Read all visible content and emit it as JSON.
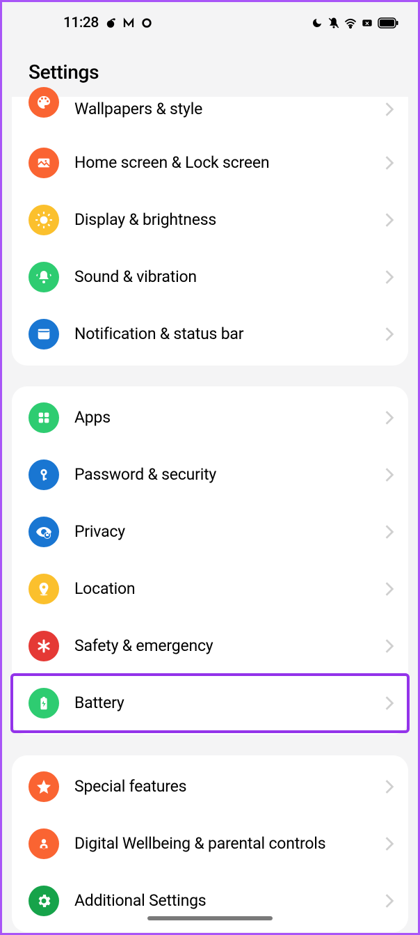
{
  "statusBar": {
    "time": "11:28"
  },
  "header": {
    "title": "Settings"
  },
  "groups": [
    {
      "items": [
        {
          "label": "Wallpapers & style",
          "icon": "palette",
          "color": "orange"
        },
        {
          "label": "Home screen & Lock screen",
          "icon": "image",
          "color": "orange"
        },
        {
          "label": "Display & brightness",
          "icon": "sun",
          "color": "yellow"
        },
        {
          "label": "Sound & vibration",
          "icon": "bell",
          "color": "green"
        },
        {
          "label": "Notification & status bar",
          "icon": "notification",
          "color": "blue"
        }
      ]
    },
    {
      "items": [
        {
          "label": "Apps",
          "icon": "apps",
          "color": "green"
        },
        {
          "label": "Password & security",
          "icon": "key",
          "color": "blue"
        },
        {
          "label": "Privacy",
          "icon": "eye",
          "color": "blue"
        },
        {
          "label": "Location",
          "icon": "location",
          "color": "yellow"
        },
        {
          "label": "Safety & emergency",
          "icon": "asterisk",
          "color": "red"
        },
        {
          "label": "Battery",
          "icon": "battery",
          "color": "green",
          "highlighted": true
        }
      ]
    },
    {
      "items": [
        {
          "label": "Special features",
          "icon": "star",
          "color": "orange"
        },
        {
          "label": "Digital Wellbeing & parental controls",
          "icon": "heart",
          "color": "orange"
        },
        {
          "label": "Additional Settings",
          "icon": "gear",
          "color": "green2"
        }
      ]
    }
  ]
}
